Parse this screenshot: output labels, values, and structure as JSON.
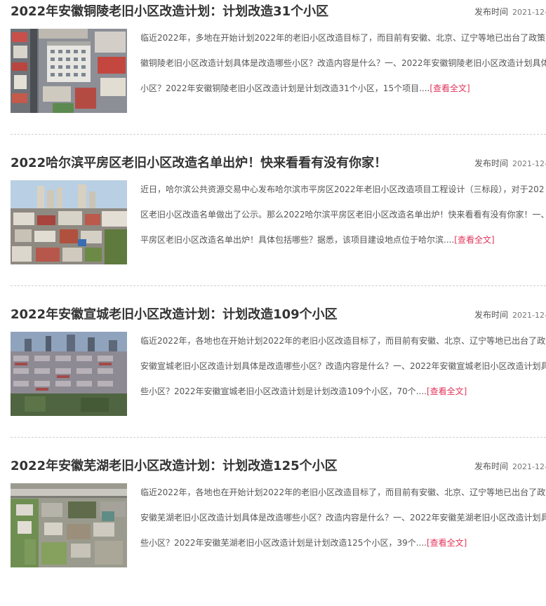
{
  "articles": [
    {
      "title": "2022年安徽铜陵老旧小区改造计划：计划改造31个小区",
      "publish_label": "发布时间",
      "publish_date": "2021-12-",
      "summary_lines": [
        "临近2022年，多地在开始计划2022年的老旧小区改造目标了，而目前有安徽、北京、辽宁等地已出台了政策",
        "徽铜陵老旧小区改造计划具体是改造哪些小区？改造内容是什么？一、2022年安徽铜陵老旧小区改造计划具体",
        "小区？2022年安徽铜陵老旧小区改造计划是计划改造31个小区，15个项目...."
      ],
      "read_more": "[查看全文]",
      "image_alt": "aerial view of dense old residential buildings"
    },
    {
      "title": "2022哈尔滨平房区老旧小区改造名单出炉！快来看看有没有你家！",
      "publish_label": "发布时间",
      "publish_date": "2021-12-",
      "summary_lines": [
        "近日，哈尔滨公共资源交易中心发布哈尔滨市平房区2022年老旧小区改造项目工程设计（三标段），对于202",
        "区老旧小区改造名单做出了公示。那么2022哈尔滨平房区老旧小区改造名单出炉！快来看看有没有你家！一、",
        "平房区老旧小区改造名单出炉！具体包括哪些？据悉，该项目建设地点位于哈尔滨...."
      ],
      "read_more": "[查看全文]",
      "image_alt": "old residential district with high-rises in background"
    },
    {
      "title": "2022年安徽宣城老旧小区改造计划：计划改造109个小区",
      "publish_label": "发布时间",
      "publish_date": "2021-12-",
      "summary_lines": [
        "临近2022年，各地也在开始计划2022年的老旧小区改造目标了，而目前有安徽、北京、辽宁等地已出台了政策",
        "安徽宣城老旧小区改造计划具体是改造哪些小区？改造内容是什么？一、2022年安徽宣城老旧小区改造计划具",
        "些小区？2022年安徽宣城老旧小区改造计划是计划改造109个小区，70个...."
      ],
      "read_more": "[查看全文]",
      "image_alt": "rows of old residential buildings at dusk"
    },
    {
      "title": "2022年安徽芜湖老旧小区改造计划：计划改造125个小区",
      "publish_label": "发布时间",
      "publish_date": "2021-12-",
      "summary_lines": [
        "临近2022年，各地也在开始计划2022年的老旧小区改造目标了，而目前有安徽、北京、辽宁等地已出台了政策",
        "安徽芜湖老旧小区改造计划具体是改造哪些小区？改造内容是什么？一、2022年安徽芜湖老旧小区改造计划具",
        "些小区？2022年安徽芜湖老旧小区改造计划是计划改造125个小区，39个...."
      ],
      "read_more": "[查看全文]",
      "image_alt": "aerial view of old neighborhood with trees and elevated road"
    }
  ],
  "colors": {
    "title": "#333333",
    "summary": "#555555",
    "read_more": "#e0345a",
    "divider": "#cfcfcf"
  }
}
